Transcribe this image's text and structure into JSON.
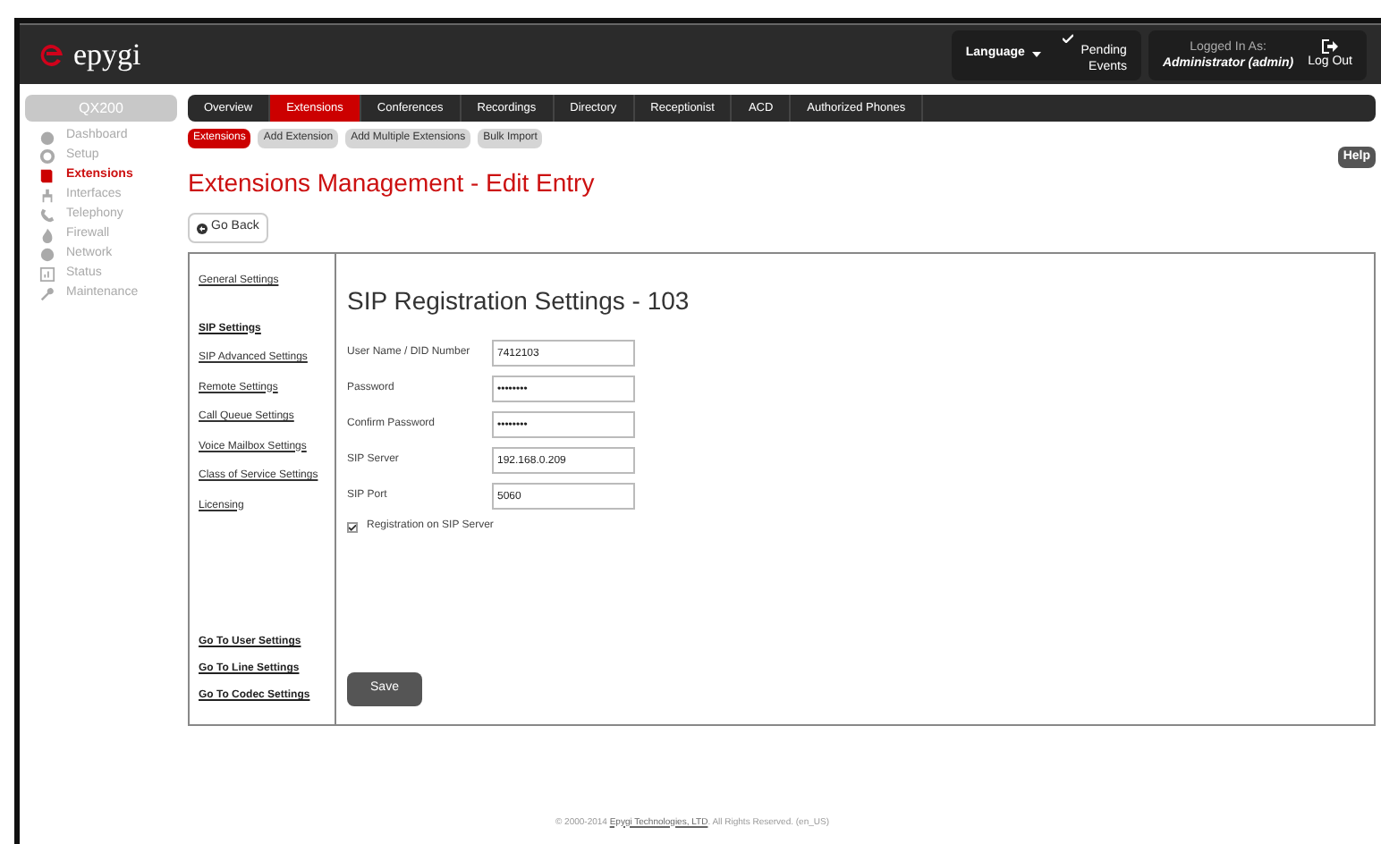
{
  "header": {
    "logo": "epygi",
    "language": "Language",
    "pending": "Pending Events",
    "logged_in_label": "Logged In As:",
    "user": "Administrator (admin)",
    "logout": "Log Out"
  },
  "device": "QX200",
  "sidebar": [
    {
      "label": "Dashboard",
      "selected": false
    },
    {
      "label": "Setup",
      "selected": false
    },
    {
      "label": "Extensions",
      "selected": true
    },
    {
      "label": "Interfaces",
      "selected": false
    },
    {
      "label": "Telephony",
      "selected": false
    },
    {
      "label": "Firewall",
      "selected": false
    },
    {
      "label": "Network",
      "selected": false
    },
    {
      "label": "Status",
      "selected": false
    },
    {
      "label": "Maintenance",
      "selected": false
    }
  ],
  "tabs": [
    {
      "label": "Overview",
      "selected": false
    },
    {
      "label": "Extensions",
      "selected": true
    },
    {
      "label": "Conferences",
      "selected": false
    },
    {
      "label": "Recordings",
      "selected": false
    },
    {
      "label": "Directory",
      "selected": false
    },
    {
      "label": "Receptionist",
      "selected": false
    },
    {
      "label": "ACD",
      "selected": false
    },
    {
      "label": "Authorized Phones",
      "selected": false
    }
  ],
  "subtabs": [
    {
      "label": "Extensions",
      "selected": true
    },
    {
      "label": "Add Extension",
      "selected": false
    },
    {
      "label": "Add Multiple Extensions",
      "selected": false
    },
    {
      "label": "Bulk Import",
      "selected": false
    }
  ],
  "page_title": "Extensions Management - Edit Entry",
  "help": "Help",
  "go_back": "Go Back",
  "settings_links": [
    {
      "label": "General Settings",
      "selected": false
    },
    {
      "label": "SIP Settings",
      "selected": true
    },
    {
      "label": "SIP Advanced Settings",
      "selected": false
    },
    {
      "label": "Remote Settings",
      "selected": false
    },
    {
      "label": "Call Queue Settings",
      "selected": false
    },
    {
      "label": "Voice Mailbox Settings",
      "selected": false
    },
    {
      "label": "Class of Service Settings",
      "selected": false
    },
    {
      "label": "Licensing",
      "selected": false
    }
  ],
  "bottom_links": [
    "Go To User Settings",
    "Go To Line Settings",
    "Go To Codec Settings"
  ],
  "form": {
    "title": "SIP Registration Settings - 103",
    "fields": [
      {
        "label": "User Name / DID Number",
        "value": "7412103"
      },
      {
        "label": "Password",
        "value": "••••••••"
      },
      {
        "label": "Confirm Password",
        "value": "••••••••"
      },
      {
        "label": "SIP Server",
        "value": "192.168.0.209"
      },
      {
        "label": "SIP Port",
        "value": "5060"
      }
    ],
    "checkbox": {
      "label": "Registration on SIP Server",
      "checked": true
    },
    "save": "Save"
  },
  "footer": {
    "before": "© 2000-2014 ",
    "link": "Epygi Technologies, LTD",
    "after": ". All Rights Reserved. (en_US)"
  }
}
